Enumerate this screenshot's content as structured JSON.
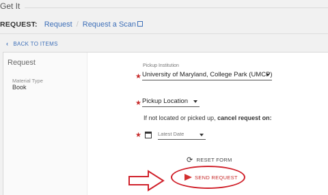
{
  "header": {
    "title": "Get It"
  },
  "request_bar": {
    "label": "REQUEST:",
    "link_request": "Request",
    "separator": "/",
    "link_scan": "Request a Scan"
  },
  "back": {
    "label": "BACK TO ITEMS"
  },
  "left": {
    "title": "Request",
    "material_type_label": "Material Type",
    "material_type_value": "Book"
  },
  "form": {
    "pickup_institution_label": "Pickup Institution",
    "pickup_institution_value": "University of Maryland, College Park (UMCP)",
    "pickup_location_value": "Pickup Location",
    "note_prefix": "If not located or picked up, ",
    "note_bold": "cancel request on:",
    "latest_date_value": "Latest Date",
    "reset_label": "RESET FORM",
    "send_label": "SEND REQUEST",
    "required_marker": "★"
  },
  "colors": {
    "accent": "#3d6fb8",
    "required": "#c62828",
    "highlight": "#d0202a"
  },
  "icons": [
    "chevron-left-icon",
    "external-link-icon",
    "calendar-icon",
    "reset-icon",
    "send-icon",
    "arrow-annotation-icon"
  ]
}
